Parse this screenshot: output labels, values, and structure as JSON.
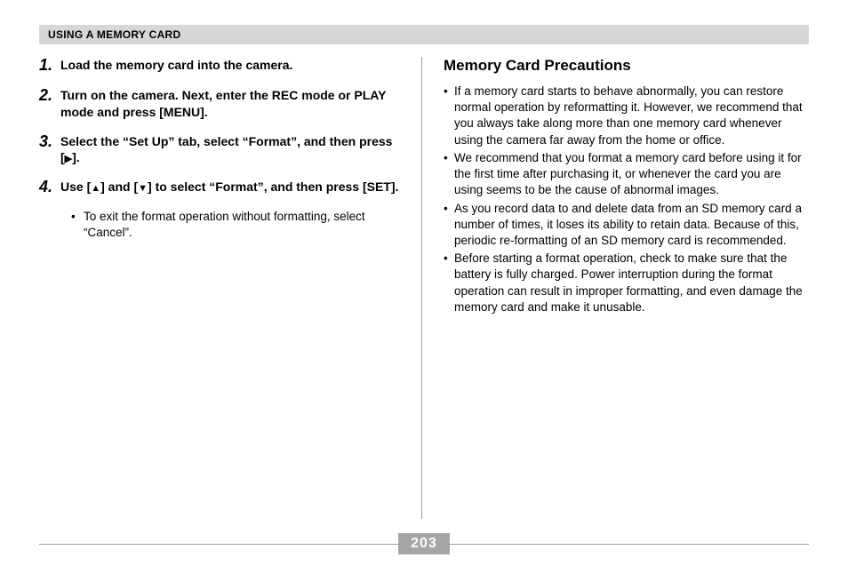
{
  "header": "USING A MEMORY CARD",
  "steps": [
    {
      "num": "1.",
      "text": "Load the memory card into the camera."
    },
    {
      "num": "2.",
      "text": "Turn on the camera. Next, enter the REC mode or PLAY mode and press [MENU]."
    },
    {
      "num": "3.",
      "pre": "Select the “Set Up” tab, select “Format”, and then press [",
      "post": "]."
    },
    {
      "num": "4.",
      "pre": "Use [",
      "mid": "] and [",
      "post": "] to select “Format”, and then press [SET]."
    }
  ],
  "sub_bullet": "To exit the format operation without formatting, select “Cancel”.",
  "right_title": "Memory Card Precautions",
  "precautions": [
    "If a memory card starts to behave abnormally, you can restore normal operation by reformatting it. However, we recommend that you always take along more than one memory card whenever using the camera far away from the home or office.",
    "We recommend that you format a memory card before using it for the first time after purchasing it, or whenever the card you are using seems to be the cause of abnormal images.",
    "As you record data to and delete data from an SD memory card a number of times, it loses its ability to retain data. Because of this, periodic re-formatting of an SD memory card is recommended.",
    "Before starting a format operation, check to make sure that the battery is fully charged. Power interruption during the format operation can result in improper formatting, and even damage the memory card and make it unusable."
  ],
  "page_number": "203"
}
